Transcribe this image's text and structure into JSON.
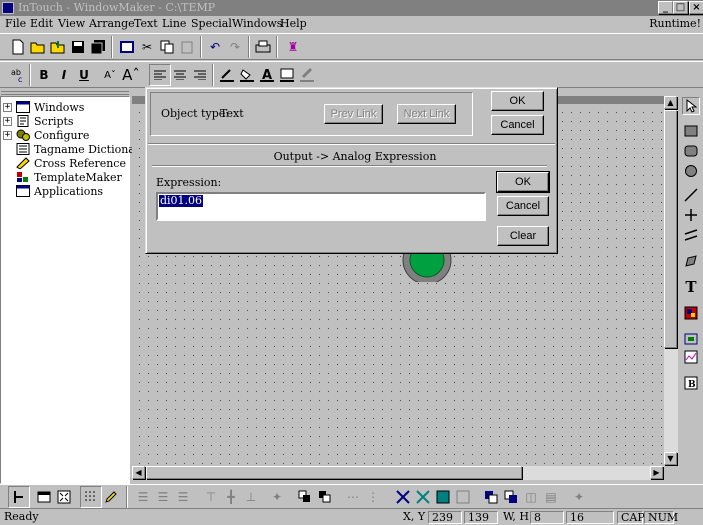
{
  "window": {
    "title": "InTouch - WindowMaker - C:\\TEMP",
    "runtime_label": "Runtime!"
  },
  "menu": [
    "File",
    "Edit",
    "View",
    "Arrange",
    "Text",
    "Line",
    "Special",
    "Windows",
    "Help"
  ],
  "tree": {
    "items": [
      {
        "label": "Windows",
        "expandable": true,
        "icon": "window-icon"
      },
      {
        "label": "Scripts",
        "expandable": true,
        "icon": "script-icon"
      },
      {
        "label": "Configure",
        "expandable": true,
        "icon": "configure-icon"
      },
      {
        "label": "Tagname Dictionary",
        "expandable": false,
        "icon": "dictionary-icon"
      },
      {
        "label": "Cross Reference",
        "expandable": false,
        "icon": "cross-reference-icon"
      },
      {
        "label": "TemplateMaker",
        "expandable": false,
        "icon": "template-icon"
      },
      {
        "label": "Applications",
        "expandable": false,
        "icon": "applications-icon"
      }
    ]
  },
  "link_dialog": {
    "object_type_label": "Object type:",
    "object_type_value": "Text",
    "prev_link": "Prev Link",
    "next_link": "Next Link",
    "ok": "OK",
    "cancel": "Cancel"
  },
  "expression_dialog": {
    "title": "Output -> Analog Expression",
    "expression_label": "Expression:",
    "expression_value": "di01.06",
    "ok": "OK",
    "cancel": "Cancel",
    "clear": "Clear"
  },
  "status": {
    "text": "Ready",
    "xy_label": "X, Y",
    "x": "239",
    "y": "139",
    "wh_label": "W, H",
    "w": "8",
    "h": "16",
    "cap": "CAP",
    "num": "NUM"
  },
  "colors": {
    "selection": "#000080",
    "indicator": "#00a040",
    "canvas": "#c0c0c0"
  }
}
